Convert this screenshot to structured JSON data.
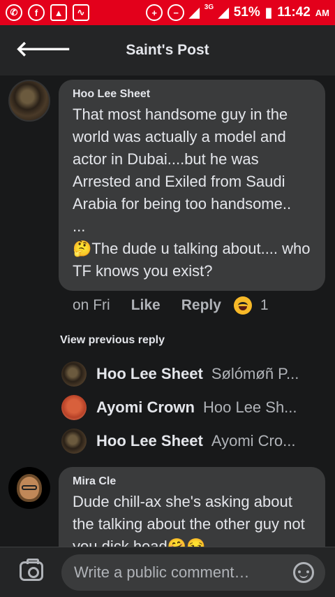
{
  "status_bar": {
    "battery": "51%",
    "time": "11:42",
    "ampm": "AM",
    "network": "3G"
  },
  "header": {
    "title": "Saint's Post"
  },
  "comment1": {
    "author": "Hoo Lee Sheet",
    "text": "That most handsome guy in the world was actually a model and actor in Dubai....but he was Arrested and Exiled from Saudi Arabia for being too handsome..\n...\n🤔The dude u talking about.... who TF knows you exist?",
    "time": "on Fri",
    "like": "Like",
    "reply": "Reply",
    "reaction_count": "1"
  },
  "view_previous": "View previous reply",
  "replies": [
    {
      "name": "Hoo Lee Sheet",
      "text": "Sølómøñ P..."
    },
    {
      "name": "Ayomi Crown",
      "text": "Hoo Lee Sh..."
    },
    {
      "name": "Hoo Lee Sheet",
      "text": "Ayomi Cro..."
    }
  ],
  "comment2": {
    "author": "Mira Cle",
    "text": "Dude chill-ax she's asking about the talking about the other guy not you dick head🤗😏"
  },
  "composer": {
    "placeholder": "Write a public comment…"
  },
  "colors": {
    "status_bar": "#e3001b",
    "background": "#18191a",
    "bubble": "#3a3b3c"
  }
}
